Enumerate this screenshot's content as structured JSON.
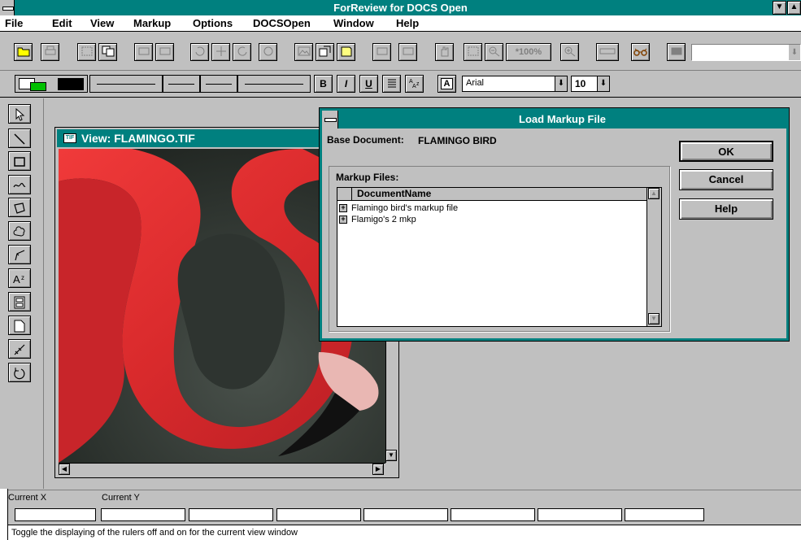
{
  "window": {
    "title": "ForReview for DOCS Open",
    "scroll_down_glyph": "▼",
    "scroll_up_glyph": "▲"
  },
  "menu": {
    "items": [
      "File",
      "Edit",
      "View",
      "Markup",
      "Options",
      "DOCSOpen",
      "Window",
      "Help"
    ]
  },
  "toolbar": {
    "zoom_label": "*100%",
    "font_name": "Arial",
    "font_size": "10",
    "bold_label": "B",
    "italic_label": "I",
    "underline_label": "U",
    "text_tool_label": "A",
    "dropdown_glyph": "⬇",
    "line_color": "#000000",
    "fill_color": "#00c000"
  },
  "view_window": {
    "title": "View: FLAMINGO.TIF",
    "icon_text": "TIF"
  },
  "dialog": {
    "title": "Load Markup File",
    "base_doc_label": "Base Document:",
    "base_doc_value": "FLAMINGO BIRD",
    "markup_files_label": "Markup Files:",
    "column_header": "DocumentName",
    "files": [
      {
        "name": "Flamingo bird's markup file"
      },
      {
        "name": "Flamigo's 2 mkp"
      }
    ],
    "buttons": {
      "ok": "OK",
      "cancel": "Cancel",
      "help": "Help"
    }
  },
  "status": {
    "current_x_label": "Current X",
    "current_y_label": "Current Y",
    "help_text": "Toggle the displaying of the rulers off and on for the current view window"
  },
  "colors": {
    "titlebar": "#00807f",
    "face": "#c0c0c0"
  }
}
